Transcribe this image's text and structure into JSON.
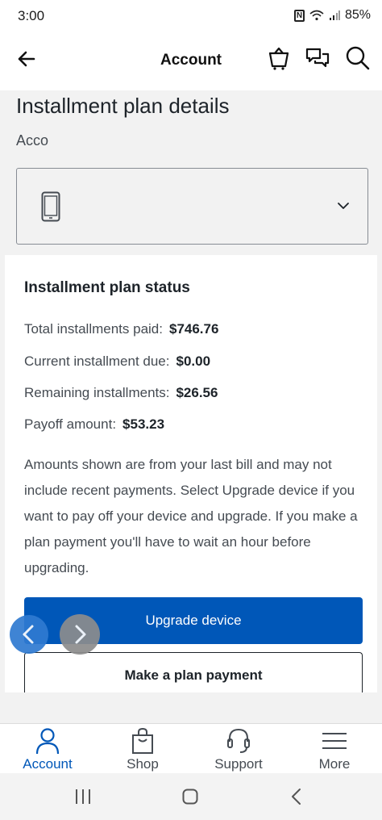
{
  "status_bar": {
    "time": "3:00",
    "battery": "85%",
    "nfc_glyph": "N"
  },
  "header": {
    "title": "Account",
    "icons": [
      "back-arrow-icon",
      "cart-icon",
      "chat-icon",
      "search-icon"
    ]
  },
  "page": {
    "title": "Installment plan details",
    "account_label": "Acco",
    "device_select_icon": "phone-icon"
  },
  "installment_status": {
    "heading": "Installment plan status",
    "rows": [
      {
        "label": "Total installments paid:",
        "value": "$746.76"
      },
      {
        "label": "Current installment due:",
        "value": "$0.00"
      },
      {
        "label": "Remaining installments:",
        "value": "$26.56"
      },
      {
        "label": "Payoff amount:",
        "value": "$53.23"
      }
    ],
    "note": "Amounts shown are from your last bill and may not include recent payments. Select Upgrade device if you want to pay off your device and upgrade. If you make a plan payment you'll have to wait an hour before upgrading."
  },
  "buttons": {
    "upgrade": "Upgrade device",
    "payment": "Make a plan payment"
  },
  "tabs": [
    {
      "label": "Account",
      "icon": "person-icon",
      "active": true
    },
    {
      "label": "Shop",
      "icon": "shopping-bag-icon",
      "active": false
    },
    {
      "label": "Support",
      "icon": "headset-icon",
      "active": false
    },
    {
      "label": "More",
      "icon": "menu-icon",
      "active": false
    }
  ],
  "colors": {
    "accent": "#0057b8",
    "text": "#1d2329",
    "background": "#f2f2f2"
  }
}
